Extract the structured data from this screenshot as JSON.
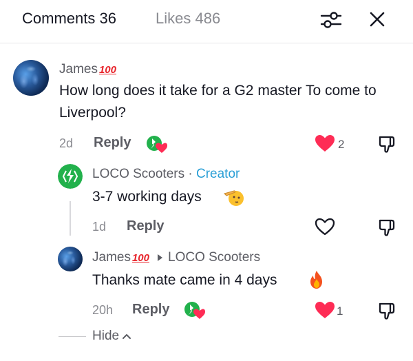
{
  "header": {
    "comments_tab": "Comments 36",
    "likes_tab": "Likes 486"
  },
  "comments": [
    {
      "username": "James",
      "username_badge": "100",
      "text": "How long does it take for a G2 master To come to Liverpool?",
      "time": "2d",
      "reply_label": "Reply",
      "likes": "2",
      "liked": true
    }
  ],
  "replies": [
    {
      "username": "LOCO Scooters",
      "separator": " · ",
      "role": "Creator",
      "text": "3-7 working days",
      "time": "1d",
      "reply_label": "Reply",
      "liked": false
    },
    {
      "username": "James",
      "username_badge": "100",
      "reply_to": "LOCO Scooters",
      "text": "Thanks mate came in 4 days",
      "time": "20h",
      "reply_label": "Reply",
      "likes": "1",
      "liked": true
    }
  ],
  "hide_label": "Hide",
  "colors": {
    "like_red": "#fe2c55",
    "brand_green": "#22b14c",
    "creator_blue": "#2a9fd6"
  }
}
